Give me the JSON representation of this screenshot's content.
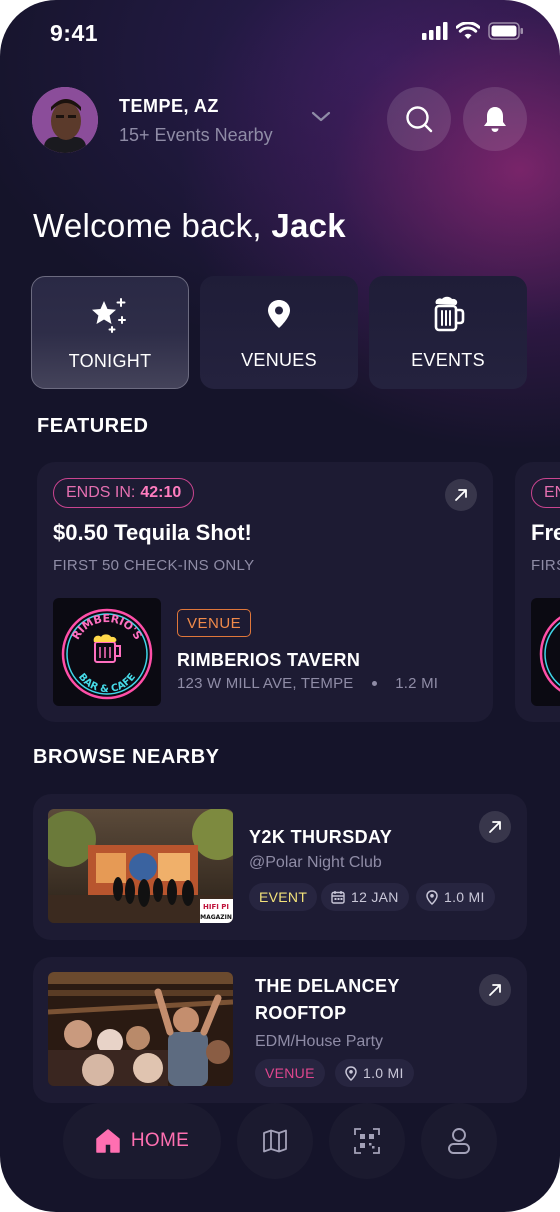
{
  "status_bar": {
    "time": "9:41"
  },
  "header": {
    "city": "TEMPE, AZ",
    "events_nearby": "15+ Events Nearby"
  },
  "welcome": {
    "prefix": "Welcome back,",
    "name": "Jack"
  },
  "categories": [
    {
      "label": "TONIGHT",
      "icon": "sparkle-star-icon",
      "active": true
    },
    {
      "label": "VENUES",
      "icon": "location-pin-icon",
      "active": false
    },
    {
      "label": "EVENTS",
      "icon": "beer-mug-icon",
      "active": false
    }
  ],
  "featured": {
    "title": "FEATURED",
    "cards": [
      {
        "ends_label": "ENDS IN:",
        "ends_time": "42:10",
        "title": "$0.50 Tequila Shot!",
        "subtitle": "FIRST 50 CHECK-INS ONLY",
        "venue_tag": "VENUE",
        "venue_name": "RIMBERIOS TAVERN",
        "venue_address": "123 W MILL AVE, TEMPE",
        "venue_distance": "1.2 MI",
        "logo_top_text": "RIMBERIO'S",
        "logo_bottom_text": "BAR & CAFE"
      },
      {
        "ends_label": "EN",
        "title": "Fre",
        "subtitle": "FIRS"
      }
    ]
  },
  "browse": {
    "title": "BROWSE NEARBY",
    "items": [
      {
        "title_lines": [
          "Y2K THURSDAY"
        ],
        "subtitle": "@Polar Night Club",
        "tag": "EVENT",
        "date": "12 JAN",
        "distance": "1.0 MI",
        "image_label": "HIFI PI MAGAZIN"
      },
      {
        "title_lines": [
          "THE DELANCEY",
          "ROOFTOP"
        ],
        "subtitle": "EDM/House Party",
        "tag": "VENUE",
        "distance": "1.0 MI"
      }
    ]
  },
  "nav": {
    "home_label": "HOME",
    "items": [
      "home-icon",
      "map-icon",
      "qr-scan-icon",
      "profile-icon"
    ]
  },
  "colors": {
    "background": "#15142a",
    "card": "#1d1b33",
    "accent_pink": "#ff6fb1",
    "venue_orange": "#f08a4a",
    "event_yellow": "#f3e27a"
  }
}
